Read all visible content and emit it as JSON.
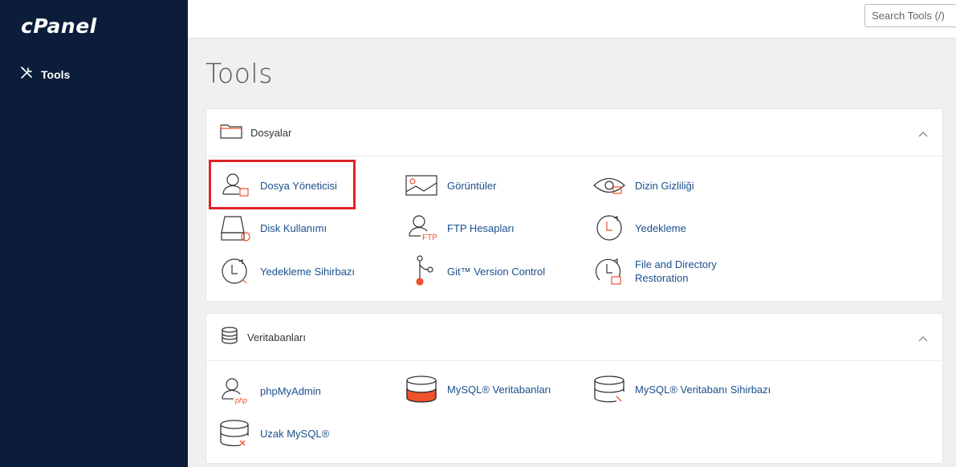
{
  "app": {
    "logo_text": "cPanel"
  },
  "sidebar": {
    "items": [
      {
        "label": "Tools",
        "icon": "tools-icon"
      }
    ]
  },
  "search": {
    "placeholder": "Search Tools (/)"
  },
  "page": {
    "title": "Tools"
  },
  "colors": {
    "sidebar_bg": "#0b1d3b",
    "link": "#1a4f8c",
    "accent_orange": "#f0522d",
    "highlight": "#e32128"
  },
  "sections": [
    {
      "title": "Dosyalar",
      "icon": "folder-icon",
      "items": [
        {
          "label": "Dosya Yöneticisi",
          "icon": "file-manager-icon"
        },
        {
          "label": "Görüntüler",
          "icon": "images-icon"
        },
        {
          "label": "Dizin Gizliliği",
          "icon": "directory-privacy-icon"
        },
        {
          "label": "Disk Kullanımı",
          "icon": "disk-usage-icon"
        },
        {
          "label": "FTP Hesapları",
          "icon": "ftp-accounts-icon"
        },
        {
          "label": "Yedekleme",
          "icon": "backup-icon"
        },
        {
          "label": "Yedekleme Sihirbazı",
          "icon": "backup-wizard-icon"
        },
        {
          "label": "Git™ Version Control",
          "icon": "git-icon"
        },
        {
          "label_line1": "File and Directory",
          "label_line2": "Restoration",
          "icon": "file-restoration-icon"
        }
      ]
    },
    {
      "title": "Veritabanları",
      "icon": "database-icon",
      "items": [
        {
          "label": "phpMyAdmin",
          "icon": "phpmyadmin-icon"
        },
        {
          "label": "MySQL® Veritabanları",
          "icon": "mysql-databases-icon"
        },
        {
          "label": "MySQL® Veritabanı Sihirbazı",
          "icon": "mysql-wizard-icon"
        },
        {
          "label": "Uzak MySQL®",
          "icon": "remote-mysql-icon"
        }
      ]
    }
  ]
}
